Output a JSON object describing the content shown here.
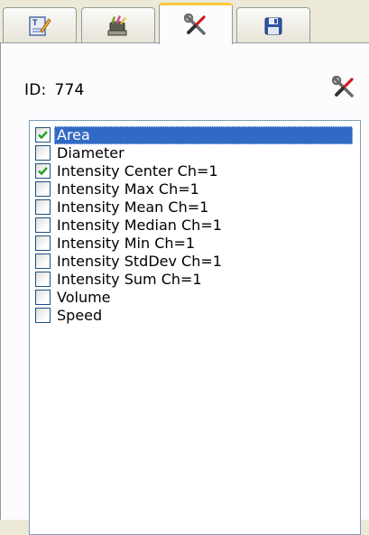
{
  "tabs": [
    {
      "icon": "edit-text-icon",
      "active": false
    },
    {
      "icon": "paint-tools-icon",
      "active": false
    },
    {
      "icon": "wrench-screwdriver-icon",
      "active": true
    },
    {
      "icon": "save-disk-icon",
      "active": false
    }
  ],
  "object": {
    "id_label": "ID:",
    "id_value": "774",
    "tools_icon": "wrench-screwdriver-icon"
  },
  "measurements": [
    {
      "label": "Area",
      "checked": true,
      "selected": true
    },
    {
      "label": "Diameter",
      "checked": false,
      "selected": false
    },
    {
      "label": "Intensity Center Ch=1",
      "checked": true,
      "selected": false
    },
    {
      "label": "Intensity Max Ch=1",
      "checked": false,
      "selected": false
    },
    {
      "label": "Intensity Mean Ch=1",
      "checked": false,
      "selected": false
    },
    {
      "label": "Intensity Median Ch=1",
      "checked": false,
      "selected": false
    },
    {
      "label": "Intensity Min Ch=1",
      "checked": false,
      "selected": false
    },
    {
      "label": "Intensity StdDev Ch=1",
      "checked": false,
      "selected": false
    },
    {
      "label": "Intensity Sum Ch=1",
      "checked": false,
      "selected": false
    },
    {
      "label": "Volume",
      "checked": false,
      "selected": false
    },
    {
      "label": "Speed",
      "checked": false,
      "selected": false
    }
  ],
  "colors": {
    "selection": "#316ac5",
    "checkmark": "#21a121",
    "active_tab_accent": "#ffc83c"
  }
}
